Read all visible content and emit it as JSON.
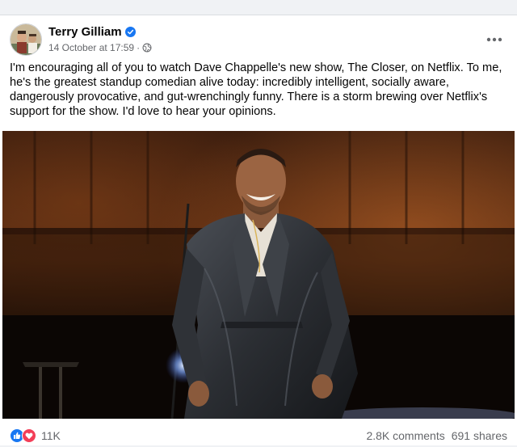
{
  "post": {
    "author": "Terry Gilliam",
    "timestamp": "14 October at 17:59",
    "separator": "·",
    "text": "I'm encouraging all of you to watch Dave Chappelle's new show, The Closer, on Netflix. To me, he's the greatest standup comedian alive today: incredibly intelligent, socially aware, dangerously provocative, and gut-wrenchingly funny. There is a storm brewing over Netflix's support for the show. I'd love to hear your opinions."
  },
  "reactions": {
    "count": "11K",
    "types": [
      "like-icon",
      "love-icon"
    ]
  },
  "stats": {
    "comments": "2.8K comments",
    "shares": "691 shares"
  },
  "colors": {
    "verified": "#1877f2",
    "like": "#1877f2",
    "love": "#f33e58",
    "secondary_text": "#65676b"
  }
}
